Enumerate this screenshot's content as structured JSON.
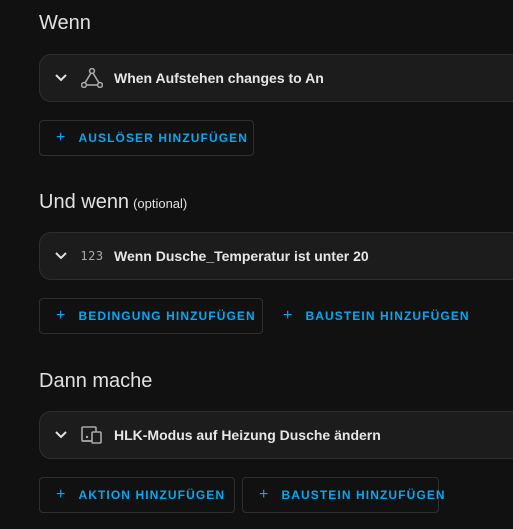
{
  "sections": [
    {
      "title": "Wenn",
      "optional": "",
      "card": {
        "icon": "graph-nodes-icon",
        "label": "When Aufstehen changes to An"
      },
      "buttons": [
        {
          "label": "AUSLÖSER HINZUFÜGEN"
        }
      ]
    },
    {
      "title": "Und wenn",
      "optional": "(optional)",
      "card": {
        "icon": "numeric-123-icon",
        "icon_text": "123",
        "label": "Wenn Dusche_Temperatur ist unter 20"
      },
      "buttons": [
        {
          "label": "BEDINGUNG HINZUFÜGEN"
        },
        {
          "label": "BAUSTEIN HINZUFÜGEN"
        }
      ]
    },
    {
      "title": "Dann mache",
      "optional": "",
      "card": {
        "icon": "devices-icon",
        "label": "HLK-Modus auf Heizung Dusche ändern"
      },
      "buttons": [
        {
          "label": "AKTION HINZUFÜGEN"
        },
        {
          "label": "BAUSTEIN HINZUFÜGEN"
        }
      ]
    }
  ],
  "plus_symbol": "+",
  "colors": {
    "background": "#111111",
    "card": "#1c1c1c",
    "accent": "#03a9f4",
    "text": "#e1e1e1",
    "icon": "#a8a8a8"
  }
}
